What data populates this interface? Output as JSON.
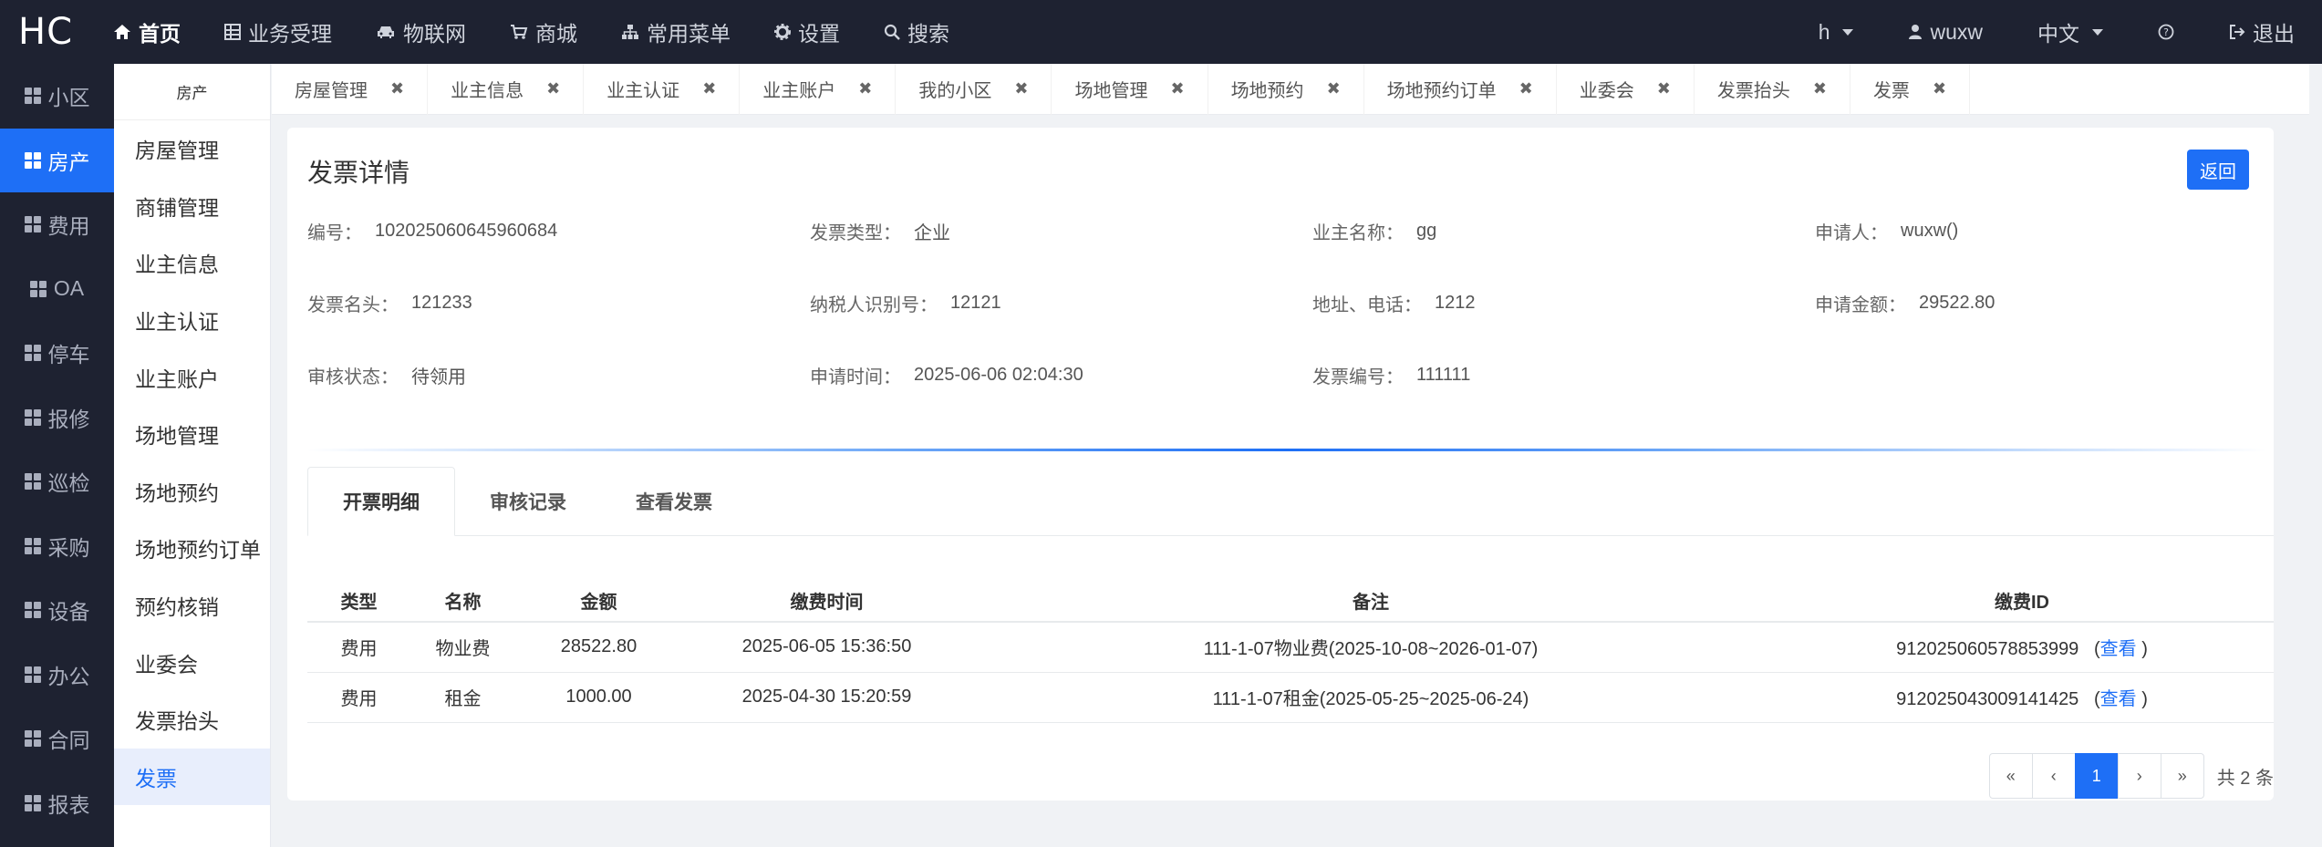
{
  "brand": "HC",
  "topnav": {
    "items": [
      {
        "icon": "home-icon",
        "label": "首页"
      },
      {
        "icon": "table-icon",
        "label": "业务受理"
      },
      {
        "icon": "car-icon",
        "label": "物联网"
      },
      {
        "icon": "cart-icon",
        "label": "商城"
      },
      {
        "icon": "sitemap-icon",
        "label": "常用菜单"
      },
      {
        "icon": "gear-icon",
        "label": "设置"
      },
      {
        "icon": "search-icon",
        "label": "搜索"
      }
    ],
    "right": {
      "h_label": "h",
      "user": "wuxw",
      "lang": "中文",
      "help_icon": "question-circle-icon",
      "logout": "退出"
    }
  },
  "leftmenu": [
    "小区",
    "房产",
    "费用",
    "OA",
    "停车",
    "报修",
    "巡检",
    "采购",
    "设备",
    "办公",
    "合同",
    "报表"
  ],
  "submenu": {
    "title": "房产",
    "items": [
      "房屋管理",
      "商铺管理",
      "业主信息",
      "业主认证",
      "业主账户",
      "场地管理",
      "场地预约",
      "场地预约订单",
      "预约核销",
      "业委会",
      "发票抬头",
      "发票"
    ]
  },
  "tabs": [
    "房屋管理",
    "业主信息",
    "业主认证",
    "业主账户",
    "我的小区",
    "场地管理",
    "场地预约",
    "场地预约订单",
    "业委会",
    "发票抬头",
    "发票"
  ],
  "detail": {
    "title": "发票详情",
    "back": "返回",
    "fields": [
      {
        "label": "编号：",
        "value": "102025060645960684"
      },
      {
        "label": "发票类型：",
        "value": "企业"
      },
      {
        "label": "业主名称：",
        "value": "gg"
      },
      {
        "label": "申请人：",
        "value": "wuxw()"
      },
      {
        "label": "发票名头：",
        "value": "121233"
      },
      {
        "label": "纳税人识别号：",
        "value": "12121"
      },
      {
        "label": "地址、电话：",
        "value": "1212"
      },
      {
        "label": "申请金额：",
        "value": "29522.80"
      },
      {
        "label": "审核状态：",
        "value": "待领用"
      },
      {
        "label": "申请时间：",
        "value": "2025-06-06 02:04:30"
      },
      {
        "label": "发票编号：",
        "value": "111111"
      }
    ],
    "tabs": [
      "开票明细",
      "审核记录",
      "查看发票"
    ],
    "table": {
      "headers": [
        "类型",
        "名称",
        "金额",
        "缴费时间",
        "备注",
        "缴费ID"
      ],
      "rows": [
        {
          "type": "费用",
          "name": "物业费",
          "amount": "28522.80",
          "time": "2025-06-05 15:36:50",
          "remark": "111-1-07物业费(2025-10-08~2026-01-07)",
          "id": "912025060578853999",
          "view_pre": "(",
          "view": "查看",
          "view_post": ")"
        },
        {
          "type": "费用",
          "name": "租金",
          "amount": "1000.00",
          "time": "2025-04-30 15:20:59",
          "remark": "111-1-07租金(2025-05-25~2025-06-24)",
          "id": "912025043009141425",
          "view_pre": "(",
          "view": "查看",
          "view_post": ")"
        }
      ]
    },
    "pager": {
      "first": "«",
      "prev": "‹",
      "current": "1",
      "next": "›",
      "last": "»",
      "total": "共 2 条"
    }
  }
}
